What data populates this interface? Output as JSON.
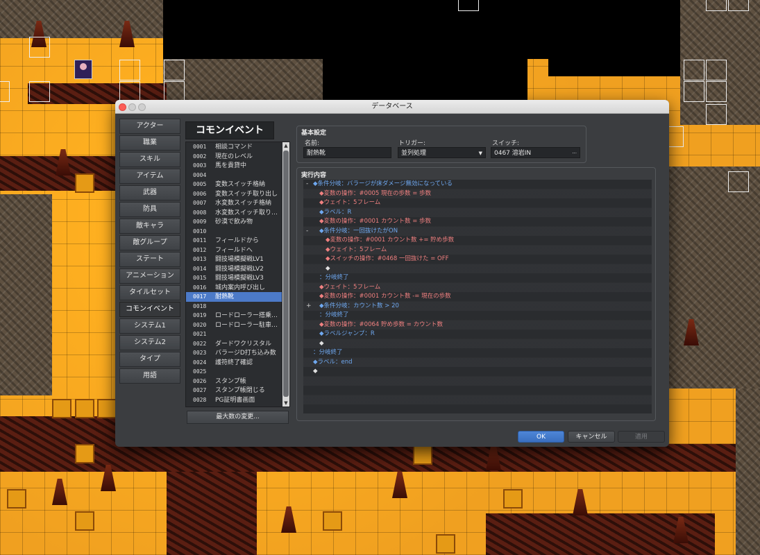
{
  "window": {
    "title": "データベース"
  },
  "tabs": [
    "アクター",
    "職業",
    "スキル",
    "アイテム",
    "武器",
    "防具",
    "敵キャラ",
    "敵グループ",
    "ステート",
    "アニメーション",
    "タイルセット",
    "コモンイベント",
    "システム1",
    "システム2",
    "タイプ",
    "用語"
  ],
  "active_tab": "コモンイベント",
  "list": {
    "header": "コモンイベント",
    "items": [
      {
        "num": "0001",
        "name": "相談コマンド"
      },
      {
        "num": "0002",
        "name": "現在のレベル"
      },
      {
        "num": "0003",
        "name": "馬を貴貸中"
      },
      {
        "num": "0004",
        "name": ""
      },
      {
        "num": "0005",
        "name": "変数スイッチ格納"
      },
      {
        "num": "0006",
        "name": "変数スイッチ取り出し"
      },
      {
        "num": "0007",
        "name": "水変数スイッチ格納"
      },
      {
        "num": "0008",
        "name": "水変数スイッチ取り…"
      },
      {
        "num": "0009",
        "name": "砂漠で飲み物"
      },
      {
        "num": "0010",
        "name": ""
      },
      {
        "num": "0011",
        "name": "フィールドから"
      },
      {
        "num": "0012",
        "name": "フィールドへ"
      },
      {
        "num": "0013",
        "name": "闘技場模擬戦LV1"
      },
      {
        "num": "0014",
        "name": "闘技場模擬戦LV2"
      },
      {
        "num": "0015",
        "name": "闘技場模擬戦LV3"
      },
      {
        "num": "0016",
        "name": "城内案内呼び出し"
      },
      {
        "num": "0017",
        "name": "耐熱靴"
      },
      {
        "num": "0018",
        "name": ""
      },
      {
        "num": "0019",
        "name": "ロードローラー搭乗…"
      },
      {
        "num": "0020",
        "name": "ロードローラー駐車…"
      },
      {
        "num": "0021",
        "name": ""
      },
      {
        "num": "0022",
        "name": "ダードワクリスタル"
      },
      {
        "num": "0023",
        "name": "バラージD打ち込み数"
      },
      {
        "num": "0024",
        "name": "護符終了確認"
      },
      {
        "num": "0025",
        "name": ""
      },
      {
        "num": "0026",
        "name": "スタンプ帳"
      },
      {
        "num": "0027",
        "name": "スタンプ帳閉じる"
      },
      {
        "num": "0028",
        "name": "PG証明書画面"
      }
    ],
    "selected": "0017",
    "max_button": "最大数の変更..."
  },
  "basic": {
    "title": "基本設定",
    "name_label": "名前:",
    "name_value": "耐熱靴",
    "trigger_label": "トリガー:",
    "trigger_value": "並列処理",
    "switch_label": "スイッチ:",
    "switch_value": "0467 溶岩IN",
    "switch_button": "···"
  },
  "exec": {
    "title": "実行内容",
    "commands": [
      {
        "indent": 0,
        "tog": "-",
        "color": "blue",
        "text": "◆条件分岐：バラージが床ダメージ無効になっている"
      },
      {
        "indent": 1,
        "tog": "",
        "color": "red",
        "text": "◆変数の操作：#0005 現在の歩数 = 歩数"
      },
      {
        "indent": 1,
        "tog": "",
        "color": "red",
        "text": "◆ウェイト：5フレーム"
      },
      {
        "indent": 1,
        "tog": "",
        "color": "blue",
        "text": "◆ラベル：R"
      },
      {
        "indent": 1,
        "tog": "",
        "color": "red",
        "text": "◆変数の操作：#0001 カウント数 = 歩数"
      },
      {
        "indent": 1,
        "tog": "-",
        "color": "blue",
        "text": "◆条件分岐：一回抜けたがON"
      },
      {
        "indent": 2,
        "tog": "",
        "color": "red",
        "text": "◆変数の操作：#0001 カウント数 += 貯め歩数"
      },
      {
        "indent": 2,
        "tog": "",
        "color": "red",
        "text": "◆ウェイト：5フレーム"
      },
      {
        "indent": 2,
        "tog": "",
        "color": "red",
        "text": "◆スイッチの操作：#0468 一回抜けた = OFF"
      },
      {
        "indent": 2,
        "tog": "",
        "color": "white",
        "text": "◆"
      },
      {
        "indent": 1,
        "tog": "",
        "color": "blue",
        "text": "：分岐終了"
      },
      {
        "indent": 1,
        "tog": "",
        "color": "red",
        "text": "◆ウェイト：5フレーム"
      },
      {
        "indent": 1,
        "tog": "",
        "color": "red",
        "text": "◆変数の操作：#0001 カウント数 -= 現在の歩数"
      },
      {
        "indent": 1,
        "tog": "+",
        "color": "blue",
        "text": "◆条件分岐：カウント数 > 20"
      },
      {
        "indent": 1,
        "tog": "",
        "color": "blue",
        "text": "：分岐終了"
      },
      {
        "indent": 1,
        "tog": "",
        "color": "red",
        "text": "◆変数の操作：#0064 貯め歩数 = カウント数"
      },
      {
        "indent": 1,
        "tog": "",
        "color": "blue",
        "text": "◆ラベルジャンプ：R"
      },
      {
        "indent": 1,
        "tog": "",
        "color": "white",
        "text": "◆"
      },
      {
        "indent": 0,
        "tog": "",
        "color": "blue",
        "text": "：分岐終了"
      },
      {
        "indent": 0,
        "tog": "",
        "color": "blue",
        "text": "◆ラベル：end"
      },
      {
        "indent": 0,
        "tog": "",
        "color": "white",
        "text": "◆"
      }
    ]
  },
  "buttons": {
    "ok": "OK",
    "cancel": "キャンセル",
    "apply": "適用"
  },
  "colors": {
    "accent": "#4c7ac8",
    "command_blue": "#6fa8f0",
    "command_red": "#f08080",
    "lava": "#f0a020"
  }
}
